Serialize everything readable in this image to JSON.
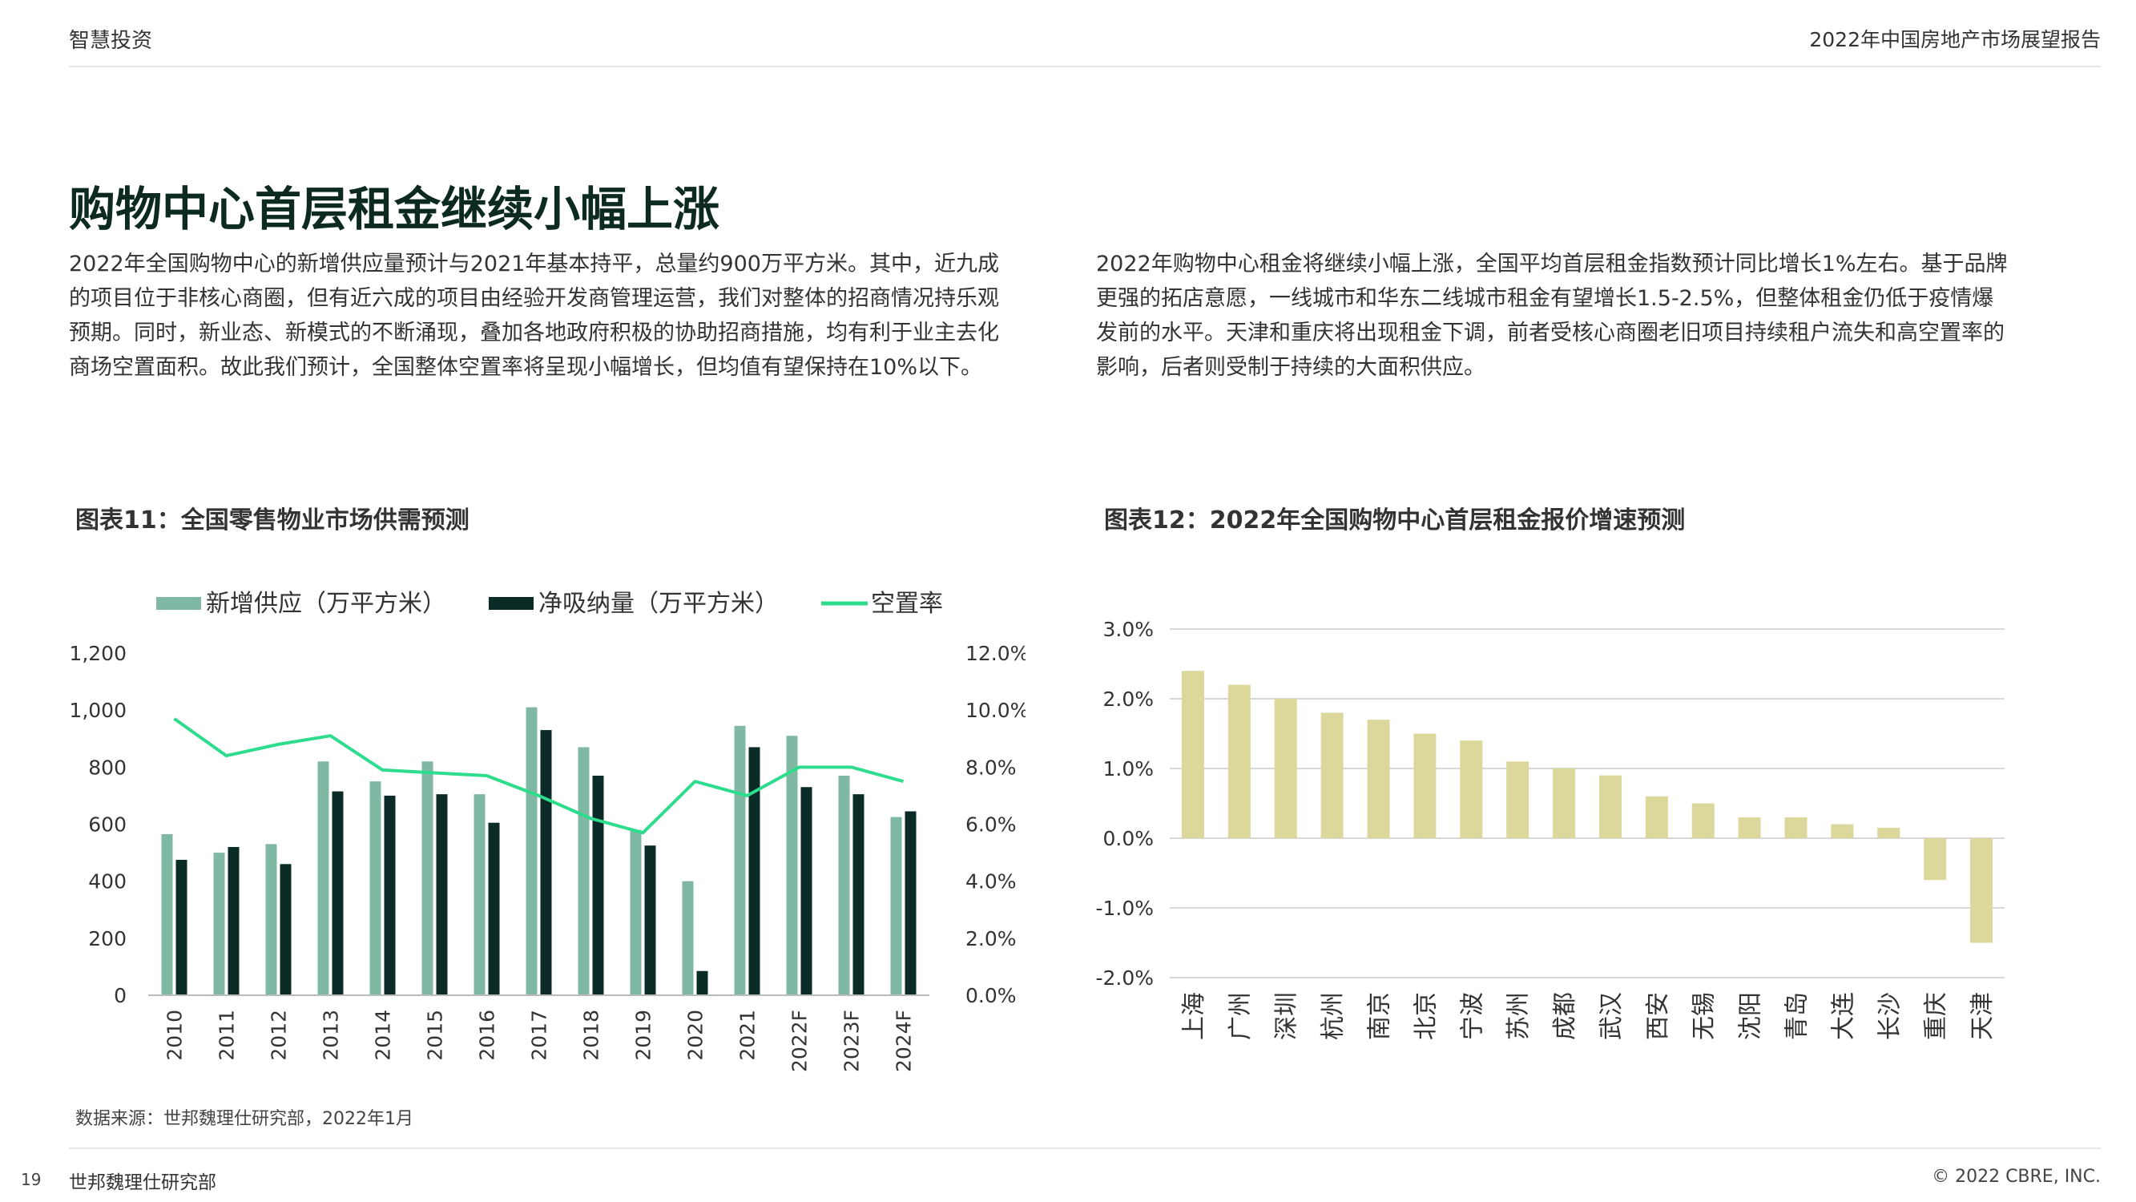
{
  "header": {
    "left": "智慧投资",
    "right": "2022年中国房地产市场展望报告"
  },
  "main": {
    "title": "购物中心首层租金继续小幅上涨",
    "para_left": "2022年全国购物中心的新增供应量预计与2021年基本持平，总量约900万平方米。其中，近九成的项目位于非核心商圈，但有近六成的项目由经验开发商管理运营，我们对整体的招商情况持乐观预期。同时，新业态、新模式的不断涌现，叠加各地政府积极的协助招商措施，均有利于业主去化商场空置面积。故此我们预计，全国整体空置率将呈现小幅增长，但均值有望保持在10%以下。",
    "para_right": "2022年购物中心租金将继续小幅上涨，全国平均首层租金指数预计同比增长1%左右。基于品牌更强的拓店意愿，一线城市和华东二线城市租金有望增长1.5-2.5%，但整体租金仍低于疫情爆发前的水平。天津和重庆将出现租金下调，前者受核心商圈老旧项目持续租户流失和高空置率的影响，后者则受制于持续的大面积供应。",
    "chart1_title": "图表11：全国零售物业市场供需预测",
    "chart2_title": "图表12：2022年全国购物中心首层租金报价增速预测",
    "source": "数据来源：世邦魏理仕研究部，2022年1月"
  },
  "footer": {
    "page_number": "19",
    "left": "世邦魏理仕研究部",
    "right": "© 2022 CBRE, INC."
  },
  "colors": {
    "supply": "#7fb8a3",
    "absorption": "#0b2b26",
    "vacancy": "#2ddc8c",
    "rent_bar": "#dcd89b"
  },
  "chart_data": [
    {
      "type": "bar",
      "categories": [
        "2010",
        "2011",
        "2012",
        "2013",
        "2014",
        "2015",
        "2016",
        "2017",
        "2018",
        "2019",
        "2020",
        "2021",
        "2022F",
        "2023F",
        "2024F"
      ],
      "series": [
        {
          "name": "新增供应（万平方米）",
          "type": "bar",
          "axis": "left",
          "values": [
            565,
            500,
            530,
            820,
            750,
            820,
            705,
            1010,
            870,
            580,
            400,
            945,
            910,
            770,
            625
          ]
        },
        {
          "name": "净吸纳量（万平方米）",
          "type": "bar",
          "axis": "left",
          "values": [
            475,
            520,
            460,
            715,
            700,
            705,
            605,
            930,
            770,
            525,
            85,
            870,
            730,
            705,
            645
          ]
        },
        {
          "name": "空置率",
          "type": "line",
          "axis": "right",
          "values": [
            9.7,
            8.4,
            8.8,
            9.1,
            7.9,
            7.8,
            7.7,
            7.0,
            6.2,
            5.7,
            7.5,
            7.0,
            8.0,
            8.0,
            7.5
          ]
        }
      ],
      "left_ticks": [
        "0",
        "200",
        "400",
        "600",
        "800",
        "1,000",
        "1,200"
      ],
      "right_ticks": [
        "0.0%",
        "2.0%",
        "4.0%",
        "6.0%",
        "8.0%",
        "10.0%",
        "12.0%"
      ],
      "ylim_left": [
        0,
        1200
      ],
      "ylim_right": [
        0,
        12
      ],
      "legend_position": "top",
      "grid": false
    },
    {
      "type": "bar",
      "categories": [
        "上海",
        "广州",
        "深圳",
        "杭州",
        "南京",
        "北京",
        "宁波",
        "苏州",
        "成都",
        "武汉",
        "西安",
        "无锡",
        "沈阳",
        "青岛",
        "大连",
        "长沙",
        "重庆",
        "天津"
      ],
      "values": [
        2.4,
        2.2,
        2.0,
        1.8,
        1.7,
        1.5,
        1.4,
        1.1,
        1.0,
        0.9,
        0.6,
        0.5,
        0.3,
        0.3,
        0.2,
        0.15,
        -0.6,
        -1.5
      ],
      "ticks": [
        "3.0%",
        "2.0%",
        "1.0%",
        "0.0%",
        "-1.0%",
        "-2.0%"
      ],
      "ylim": [
        -2,
        3
      ],
      "grid": true
    }
  ]
}
